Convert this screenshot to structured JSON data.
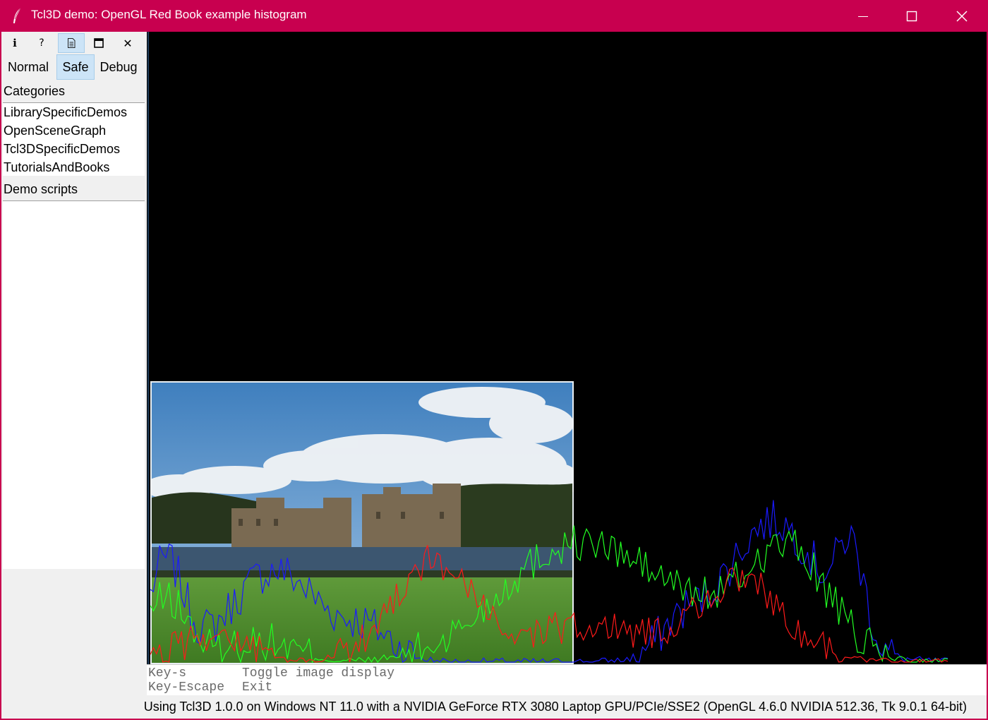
{
  "window": {
    "title": "Tcl3D demo: OpenGL Red Book example histogram",
    "title_bar_color": "#c8004f",
    "app_icon": "feather-icon",
    "controls": [
      "minimize-icon",
      "maximize-icon",
      "close-icon"
    ]
  },
  "toolbar": {
    "buttons": [
      {
        "icon": "info-icon",
        "glyph": "i",
        "active": false
      },
      {
        "icon": "help-icon",
        "glyph": "?",
        "active": false
      },
      {
        "icon": "document-icon",
        "glyph": "",
        "active": true
      },
      {
        "icon": "fullscreen-icon",
        "glyph": "",
        "active": false
      },
      {
        "icon": "close-icon",
        "glyph": "✕",
        "active": false
      }
    ]
  },
  "modes": {
    "normal": "Normal",
    "safe": "Safe",
    "debug": "Debug",
    "selected": "Safe"
  },
  "categories": {
    "label": "Categories",
    "items": [
      "LibrarySpecificDemos",
      "OpenSceneGraph",
      "Tcl3DSpecificDemos",
      "TutorialsAndBooks"
    ]
  },
  "scripts": {
    "label": "Demo scripts",
    "items": []
  },
  "console": {
    "lines": [
      {
        "key": "Key-s",
        "action": "Toggle image display"
      },
      {
        "key": "Key-Escape",
        "action": "Exit"
      }
    ]
  },
  "status_text": "Using Tcl3D 1.0.0 on Windows NT 11.0 with a NVIDIA GeForce RTX 3080 Laptop GPU/PCIe/SSE2 (OpenGL 4.6.0 NVIDIA 512.36, Tk 9.0.1 64-bit)",
  "histogram_colors": {
    "red": "#ff1a1a",
    "green": "#22ff22",
    "blue": "#1a1aff"
  }
}
